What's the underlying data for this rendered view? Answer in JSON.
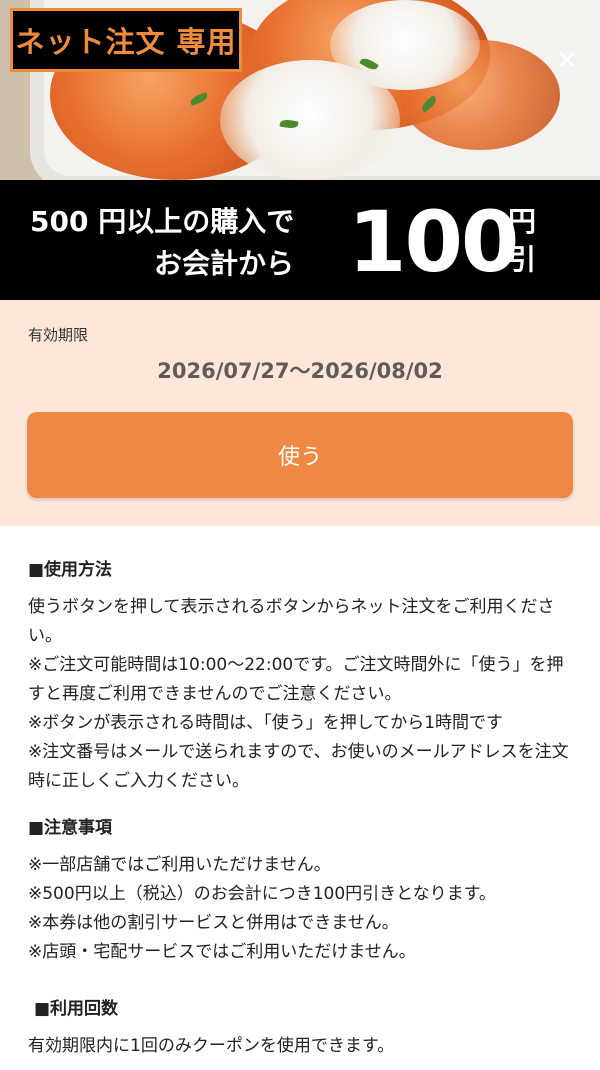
{
  "hero": {
    "tag_label": "ネット注文 専用",
    "close_symbol": "✕"
  },
  "banner": {
    "line1": "500 円以上の購入で",
    "line2": "お会計から",
    "amount": "100",
    "unit_top": "円",
    "unit_bottom": "引"
  },
  "validity": {
    "label": "有効期限",
    "range": "2026/07/27〜2026/08/02"
  },
  "use_button": {
    "label": "使う"
  },
  "usage": {
    "heading": "■使用方法",
    "lines": [
      "使うボタンを押して表示されるボタンからネット注文をご利用ください。",
      "※ご注文可能時間は10:00〜22:00です。ご注文時間外に「使う」を押すと再度ご利用できませんのでご注意ください。",
      "※ボタンが表示される時間は、「使う」を押してから1時間です",
      "※注文番号はメールで送られますので、お使いのメールアドレスを注文時に正しくご入力ください。"
    ]
  },
  "notes": {
    "heading": "■注意事項",
    "lines": [
      "※一部店舗ではご利用いただけません。",
      "※500円以上（税込）のお会計につき100円引きとなります。",
      "※本券は他の割引サービスと併用はできません。",
      "※店頭・宅配サービスではご利用いただけません。"
    ]
  },
  "count": {
    "heading": "■利用回数",
    "lines": [
      "有効期限内に1回のみクーポンを使用できます。"
    ]
  },
  "colors": {
    "accent": "#ef8844",
    "panel_bg": "#fde6da",
    "banner_bg": "#000000"
  }
}
